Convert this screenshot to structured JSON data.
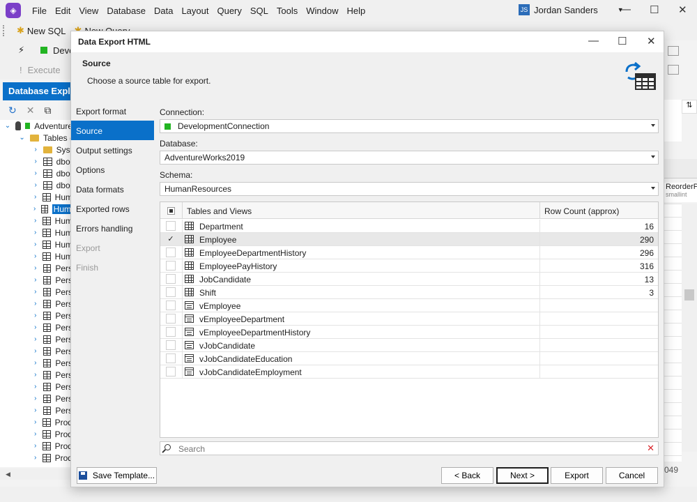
{
  "app": {
    "menu": [
      "File",
      "Edit",
      "View",
      "Database",
      "Data",
      "Layout",
      "Query",
      "SQL",
      "Tools",
      "Window",
      "Help"
    ],
    "user_initials": "JS",
    "user_name": "Jordan Sanders"
  },
  "toolbar": {
    "new_sql": "New SQL",
    "new_query": "New Query",
    "connection_short": "Deve",
    "execute": "Execute"
  },
  "explorer": {
    "title": "Database Explorer",
    "tree": [
      {
        "label": "Adventure",
        "icon": "database-icon",
        "arrow": "v",
        "indent": 0,
        "selected": false,
        "status": "connected"
      },
      {
        "label": "Tables (",
        "icon": "folder-icon",
        "arrow": "v",
        "indent": 1,
        "selected": false
      },
      {
        "label": "Syst",
        "icon": "folder-icon",
        "arrow": ">",
        "indent": 2,
        "selected": false
      },
      {
        "label": "dbo.",
        "icon": "table-icon",
        "arrow": ">",
        "indent": 2,
        "selected": false
      },
      {
        "label": "dbo.",
        "icon": "table-icon",
        "arrow": ">",
        "indent": 2,
        "selected": false
      },
      {
        "label": "dbo.",
        "icon": "table-icon",
        "arrow": ">",
        "indent": 2,
        "selected": false
      },
      {
        "label": "Hum",
        "icon": "table-icon",
        "arrow": ">",
        "indent": 2,
        "selected": false
      },
      {
        "label": "Hum",
        "icon": "table-icon",
        "arrow": ">",
        "indent": 2,
        "selected": true
      },
      {
        "label": "Hum",
        "icon": "table-icon",
        "arrow": ">",
        "indent": 2,
        "selected": false
      },
      {
        "label": "Hum",
        "icon": "table-icon",
        "arrow": ">",
        "indent": 2,
        "selected": false
      },
      {
        "label": "Hum",
        "icon": "table-icon",
        "arrow": ">",
        "indent": 2,
        "selected": false
      },
      {
        "label": "Hum",
        "icon": "table-icon",
        "arrow": ">",
        "indent": 2,
        "selected": false
      },
      {
        "label": "Pers",
        "icon": "table-icon",
        "arrow": ">",
        "indent": 2,
        "selected": false
      },
      {
        "label": "Pers",
        "icon": "table-icon",
        "arrow": ">",
        "indent": 2,
        "selected": false
      },
      {
        "label": "Pers",
        "icon": "table-icon",
        "arrow": ">",
        "indent": 2,
        "selected": false
      },
      {
        "label": "Pers",
        "icon": "table-icon",
        "arrow": ">",
        "indent": 2,
        "selected": false
      },
      {
        "label": "Pers",
        "icon": "table-icon",
        "arrow": ">",
        "indent": 2,
        "selected": false
      },
      {
        "label": "Pers",
        "icon": "table-icon",
        "arrow": ">",
        "indent": 2,
        "selected": false
      },
      {
        "label": "Pers",
        "icon": "table-icon",
        "arrow": ">",
        "indent": 2,
        "selected": false
      },
      {
        "label": "Pers",
        "icon": "table-icon",
        "arrow": ">",
        "indent": 2,
        "selected": false
      },
      {
        "label": "Pers",
        "icon": "table-icon",
        "arrow": ">",
        "indent": 2,
        "selected": false
      },
      {
        "label": "Pers",
        "icon": "table-icon",
        "arrow": ">",
        "indent": 2,
        "selected": false
      },
      {
        "label": "Pers",
        "icon": "table-icon",
        "arrow": ">",
        "indent": 2,
        "selected": false
      },
      {
        "label": "Pers",
        "icon": "table-icon",
        "arrow": ">",
        "indent": 2,
        "selected": false
      },
      {
        "label": "Pers",
        "icon": "table-icon",
        "arrow": ">",
        "indent": 2,
        "selected": false
      },
      {
        "label": "Prod",
        "icon": "table-icon",
        "arrow": ">",
        "indent": 2,
        "selected": false
      },
      {
        "label": "Prod",
        "icon": "table-icon",
        "arrow": ">",
        "indent": 2,
        "selected": false
      },
      {
        "label": "Prod",
        "icon": "table-icon",
        "arrow": ">",
        "indent": 2,
        "selected": false
      },
      {
        "label": "Prod",
        "icon": "table-icon",
        "arrow": ">",
        "indent": 2,
        "selected": false
      }
    ]
  },
  "background_grid": {
    "column_name": "ReorderP",
    "column_type": "smallint",
    "footer_value": "049"
  },
  "dialog": {
    "title": "Data Export HTML",
    "page_title": "Source",
    "page_subtitle": "Choose a source table for export.",
    "nav": [
      {
        "label": "Export format",
        "state": "normal"
      },
      {
        "label": "Source",
        "state": "active"
      },
      {
        "label": "Output settings",
        "state": "normal"
      },
      {
        "label": "Options",
        "state": "normal"
      },
      {
        "label": "Data formats",
        "state": "normal"
      },
      {
        "label": "Exported rows",
        "state": "normal"
      },
      {
        "label": "Errors handling",
        "state": "normal"
      },
      {
        "label": "Export",
        "state": "disabled"
      },
      {
        "label": "Finish",
        "state": "disabled"
      }
    ],
    "connection_label": "Connection:",
    "connection_value": "DevelopmentConnection",
    "database_label": "Database:",
    "database_value": "AdventureWorks2019",
    "schema_label": "Schema:",
    "schema_value": "HumanResources",
    "grid": {
      "col_tables": "Tables and Views",
      "col_rowcount": "Row Count (approx)",
      "rows": [
        {
          "name": "Department",
          "kind": "table",
          "count": "16",
          "checked": false
        },
        {
          "name": "Employee",
          "kind": "table",
          "count": "290",
          "checked": true
        },
        {
          "name": "EmployeeDepartmentHistory",
          "kind": "table",
          "count": "296",
          "checked": false
        },
        {
          "name": "EmployeePayHistory",
          "kind": "table",
          "count": "316",
          "checked": false
        },
        {
          "name": "JobCandidate",
          "kind": "table",
          "count": "13",
          "checked": false
        },
        {
          "name": "Shift",
          "kind": "table",
          "count": "3",
          "checked": false
        },
        {
          "name": "vEmployee",
          "kind": "view",
          "count": "",
          "checked": false
        },
        {
          "name": "vEmployeeDepartment",
          "kind": "view",
          "count": "",
          "checked": false
        },
        {
          "name": "vEmployeeDepartmentHistory",
          "kind": "view",
          "count": "",
          "checked": false
        },
        {
          "name": "vJobCandidate",
          "kind": "view",
          "count": "",
          "checked": false
        },
        {
          "name": "vJobCandidateEducation",
          "kind": "view",
          "count": "",
          "checked": false
        },
        {
          "name": "vJobCandidateEmployment",
          "kind": "view",
          "count": "",
          "checked": false
        }
      ]
    },
    "search_placeholder": "Search",
    "buttons": {
      "save_template": "Save Template...",
      "back": "< Back",
      "next": "Next >",
      "export": "Export",
      "cancel": "Cancel"
    }
  },
  "colors": {
    "accent": "#0a70c9",
    "connection_status": "#22b422",
    "app_logo": "#7b3fc8",
    "search_clear": "#d9252b"
  }
}
